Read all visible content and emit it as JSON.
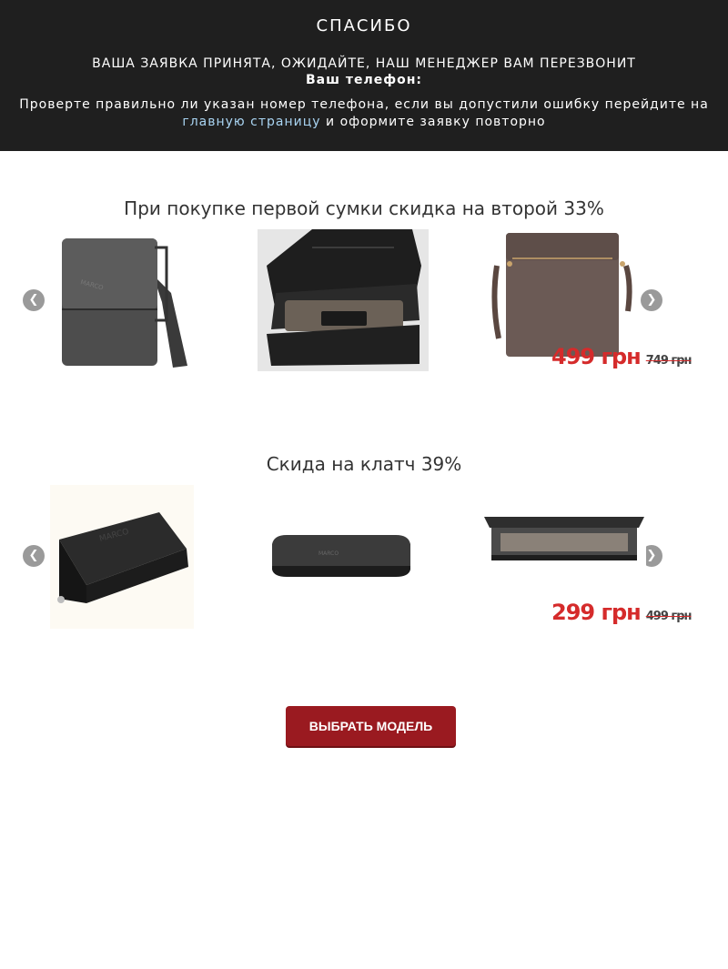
{
  "header": {
    "title": "СПАСИБО",
    "confirmation": "ВАША ЗАЯВКА ПРИНЯТА, ОЖИДАЙТЕ, НАШ МЕНЕДЖЕР ВАМ ПЕРЕЗВОНИТ",
    "phone_label": "Ваш телефон:",
    "notice_part1": "Проверте правильно ли указан номер телефона, если вы допустили ошибку перейдите на",
    "notice_link": "главную страницу",
    "notice_part2": "и оформите заявку повторно"
  },
  "bags_section": {
    "title": "При покупке первой сумки скидка на второй 33%",
    "price_new": "499 грн",
    "price_old": "749 грн"
  },
  "clutch_section": {
    "title": "Скида на клатч 39%",
    "price_new": "299 грн",
    "price_old": "499 грн"
  },
  "cta": {
    "label": "ВЫБРАТЬ МОДЕЛЬ"
  },
  "colors": {
    "header_bg": "#1f1f1f",
    "price_red": "#d52b2b",
    "cta_bg": "#9a1a20",
    "link": "#a9d4f2"
  },
  "icons": {
    "prev": "chevron-left-icon",
    "next": "chevron-right-icon"
  }
}
